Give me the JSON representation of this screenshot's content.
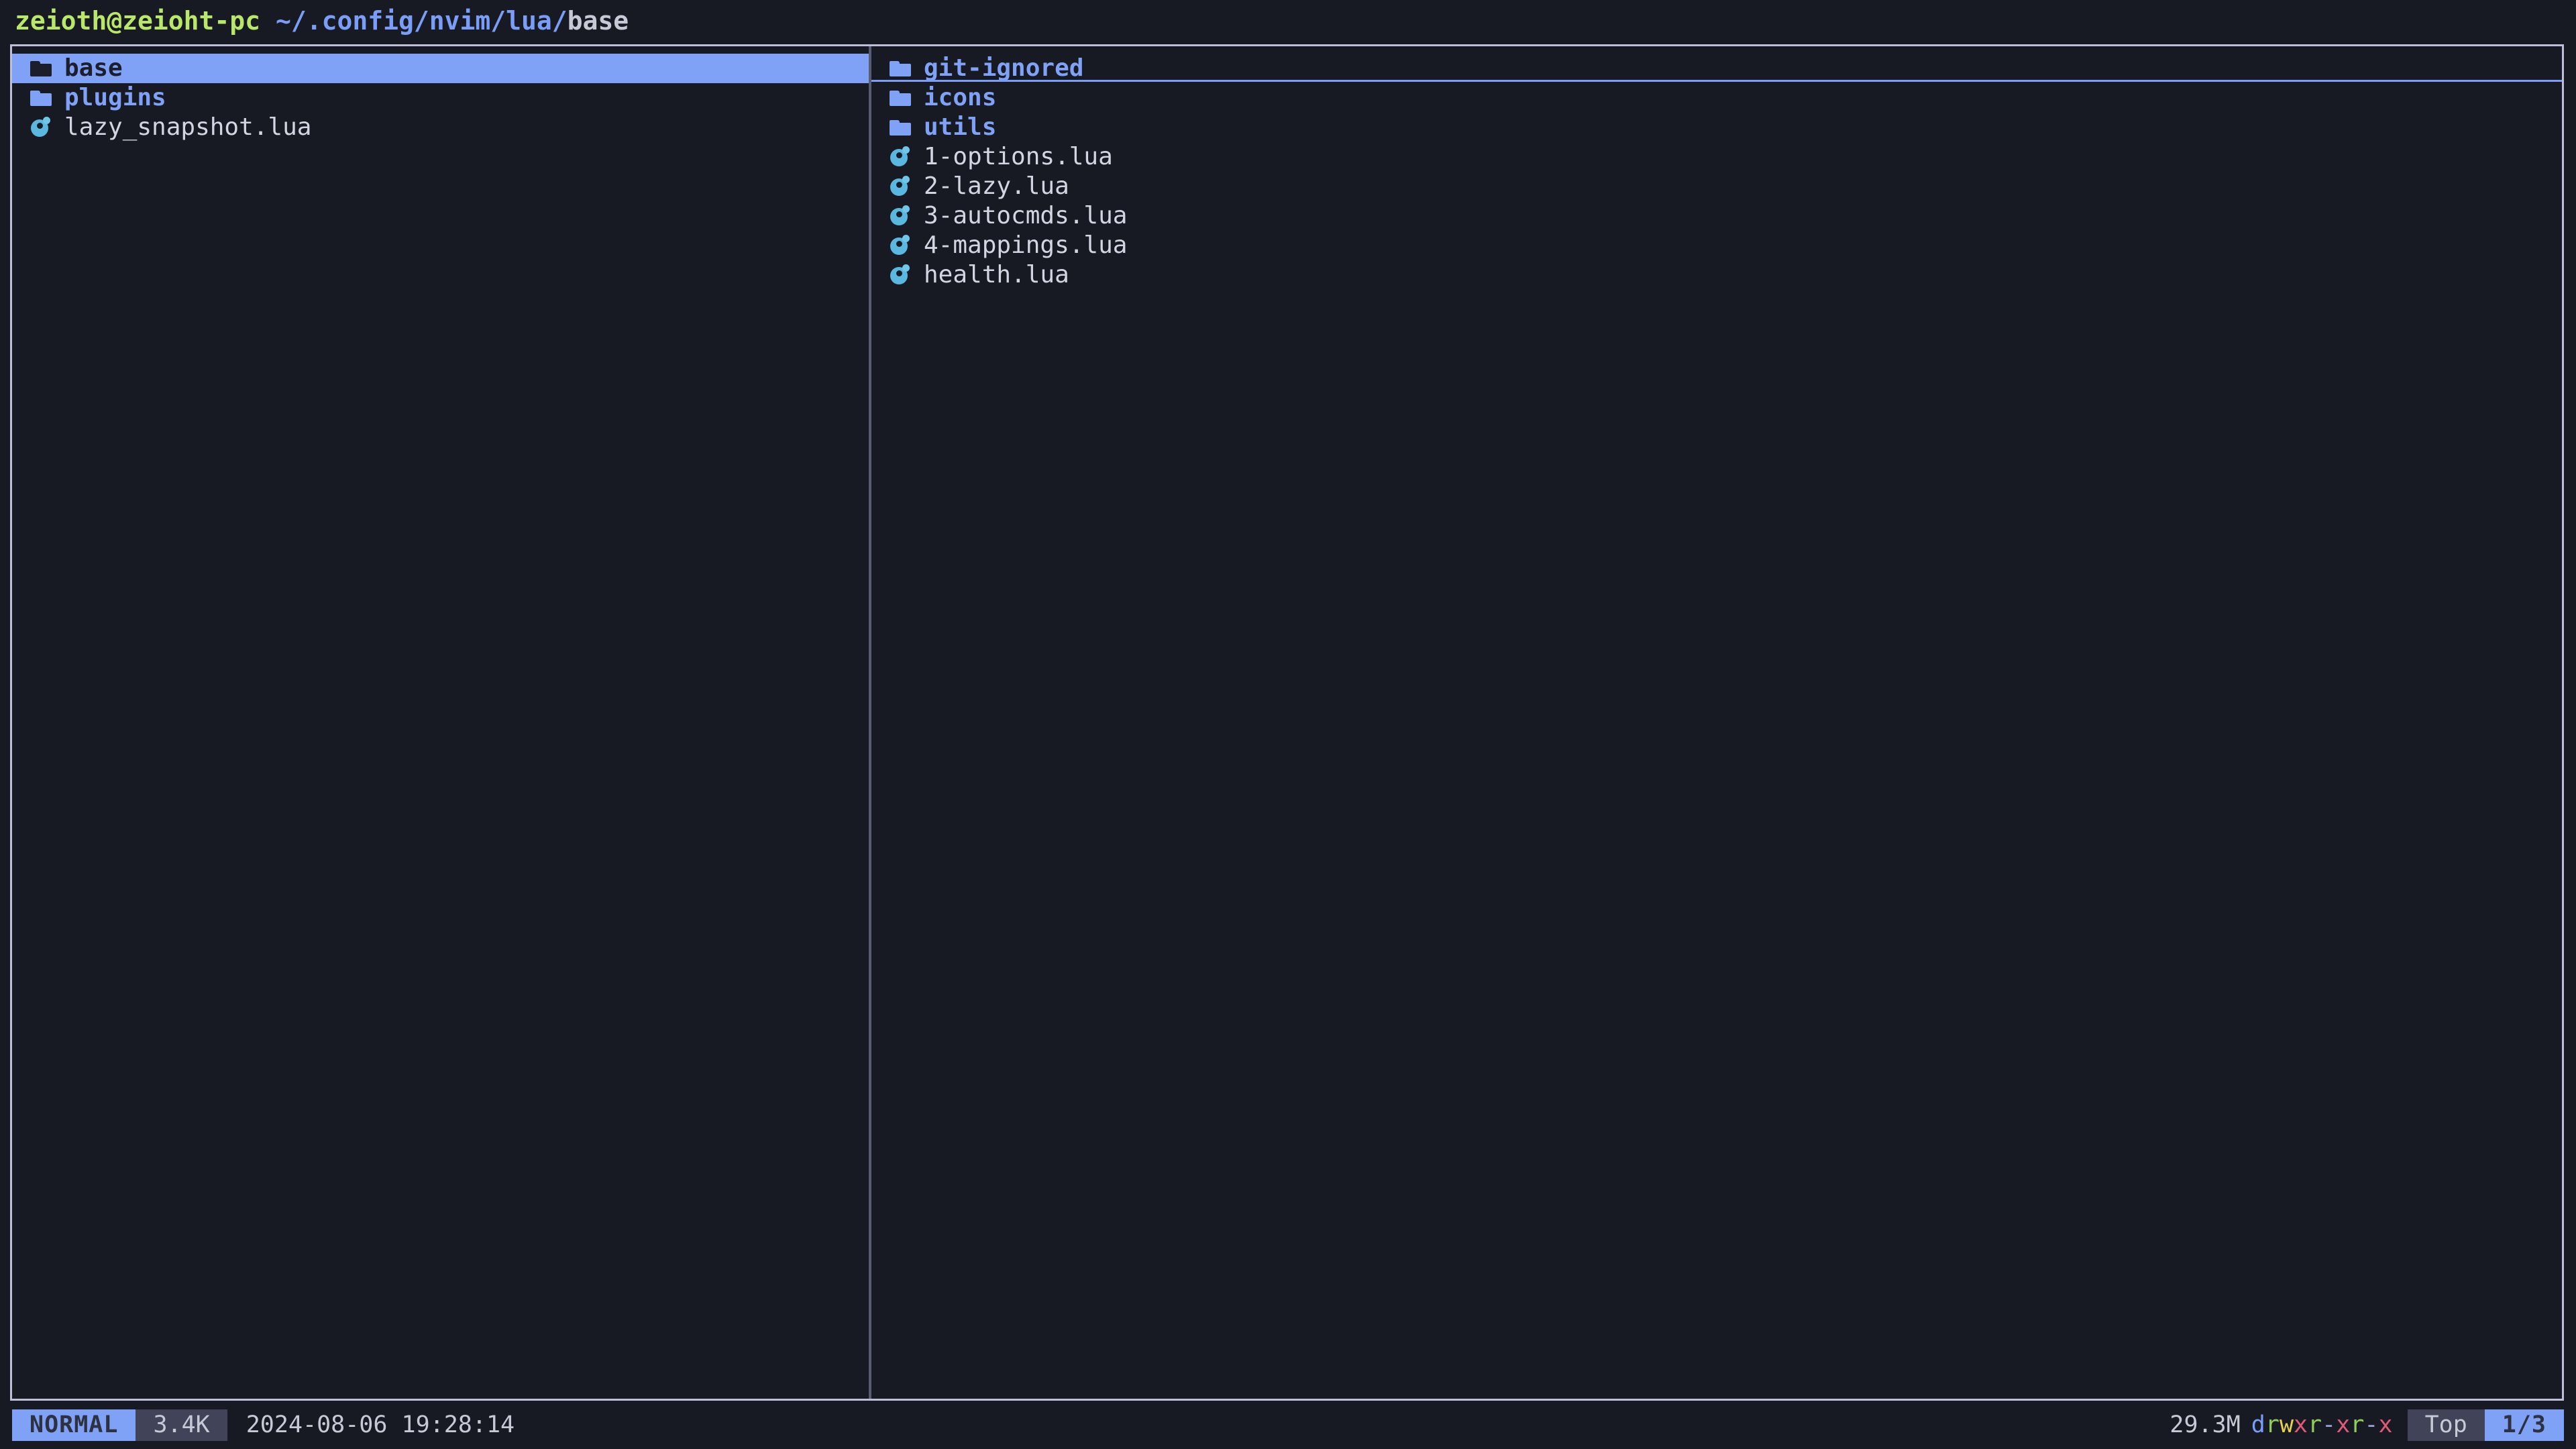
{
  "titlebar": {
    "user_host": "zeioth@zeioht-pc",
    "separator": " ",
    "path_prefix": "~/.config/nvim/lua/",
    "cwd": "base"
  },
  "panels": {
    "left": {
      "name": "parent-directory-panel",
      "items": [
        {
          "label": "base",
          "type": "folder",
          "icon": "folder-icon",
          "selected": true,
          "cursorline": false
        },
        {
          "label": "plugins",
          "type": "folder",
          "icon": "folder-icon",
          "selected": false,
          "cursorline": false
        },
        {
          "label": "lazy_snapshot.lua",
          "type": "file",
          "icon": "lua-icon",
          "selected": false,
          "cursorline": false
        }
      ]
    },
    "right": {
      "name": "current-directory-panel",
      "items": [
        {
          "label": "git-ignored",
          "type": "folder",
          "icon": "folder-icon",
          "selected": false,
          "cursorline": true
        },
        {
          "label": "icons",
          "type": "folder",
          "icon": "folder-icon",
          "selected": false,
          "cursorline": false
        },
        {
          "label": "utils",
          "type": "folder",
          "icon": "folder-icon",
          "selected": false,
          "cursorline": false
        },
        {
          "label": "1-options.lua",
          "type": "file",
          "icon": "lua-icon",
          "selected": false,
          "cursorline": false
        },
        {
          "label": "2-lazy.lua",
          "type": "file",
          "icon": "lua-icon",
          "selected": false,
          "cursorline": false
        },
        {
          "label": "3-autocmds.lua",
          "type": "file",
          "icon": "lua-icon",
          "selected": false,
          "cursorline": false
        },
        {
          "label": "4-mappings.lua",
          "type": "file",
          "icon": "lua-icon",
          "selected": false,
          "cursorline": false
        },
        {
          "label": "health.lua",
          "type": "file",
          "icon": "lua-icon",
          "selected": false,
          "cursorline": false
        }
      ]
    }
  },
  "statusbar": {
    "mode": "NORMAL",
    "filesize": "3.4K",
    "timestamp": "2024-08-06 19:28:14",
    "total_size": "29.3M",
    "permissions": "drwxr-xr-x",
    "permission_chars": [
      "d",
      "r",
      "w",
      "x",
      "r",
      "-",
      "x",
      "r",
      "-",
      "x"
    ],
    "scroll_position": "Top",
    "pagination": "1/3"
  },
  "colors": {
    "background": "#181a23",
    "accent": "#7fa2f7",
    "border": "#bdbfd8",
    "divider": "#585c70",
    "muted_badge": "#414458",
    "text": "#c6c9d6",
    "directory": "#7fa2f7",
    "file": "#d3d6e2",
    "user_host": "#b9e76a",
    "path": "#7a9ef8",
    "lua_icon": "#5ab7df",
    "perm_read": "#8fce5a",
    "perm_write": "#e6d24a",
    "perm_exec": "#e05a78",
    "perm_none": "#9aa0d6"
  }
}
